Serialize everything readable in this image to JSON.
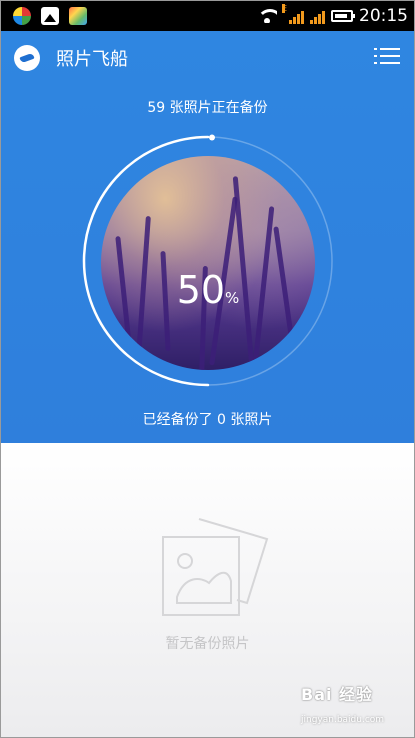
{
  "status_bar": {
    "time": "20:15",
    "network_label": "E",
    "icons": [
      "app-notification-icon",
      "image-notification-icon",
      "gallery-notification-icon",
      "wifi-icon",
      "signal-icon",
      "battery-icon"
    ]
  },
  "header": {
    "title": "照片飞船",
    "logo": "airship-logo-icon",
    "menu_icon": "menu-icon"
  },
  "backup": {
    "status_text": "59 张照片正在备份",
    "percent_value": "50",
    "percent_sign": "%",
    "progress": 0.5,
    "backed_up_text": "已经备份了 0 张照片"
  },
  "empty_state": {
    "icon": "photo-placeholder-icon",
    "text": "暂无备份照片"
  },
  "watermark": {
    "logo_text": "Bai 经验",
    "url": "jingyan.baidu.com"
  },
  "colors": {
    "primary_blue": "#2f86e1",
    "empty_text": "#c5c5c7",
    "status_bar": "#000000",
    "signal": "#f29a1d"
  }
}
